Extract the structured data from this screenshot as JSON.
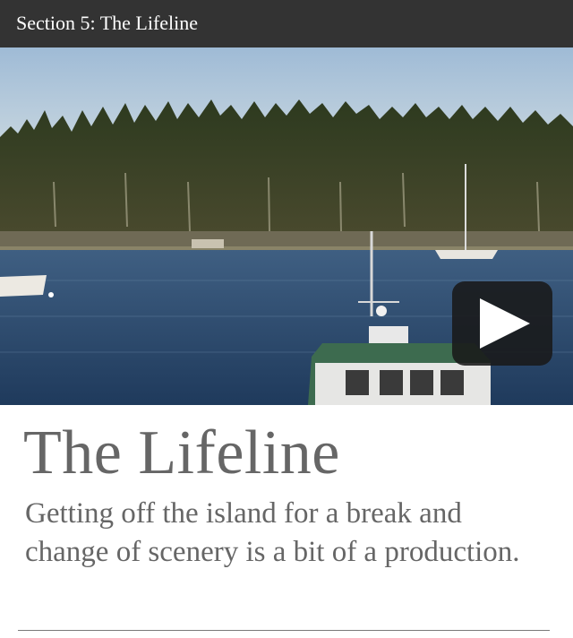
{
  "header": {
    "section_title": "Section 5: The Lifeline"
  },
  "video": {
    "play_icon": "play-icon",
    "colors": {
      "sky": "#a9c4dd",
      "water": "#2d4b6e",
      "forest": "#2f3a20",
      "hull_green": "#3d6b4f"
    }
  },
  "article": {
    "headline": "The Lifeline",
    "dek": "Getting off the island for a break and change of scenery is a bit of a production."
  }
}
